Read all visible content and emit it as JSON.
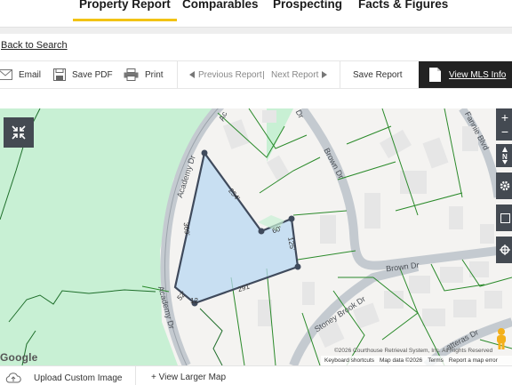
{
  "tabs": [
    {
      "label": "Property Report",
      "active": true
    },
    {
      "label": "Comparables",
      "active": false
    },
    {
      "label": "Prospecting",
      "active": false
    },
    {
      "label": "Facts & Figures",
      "active": false
    }
  ],
  "back_link": "Back to Search",
  "toolbar": {
    "email": "Email",
    "save_pdf": "Save PDF",
    "print": "Print",
    "previous_report": "Previous Report",
    "next_report": "Next Report",
    "save_report": "Save Report",
    "view_mls": "View MLS Info"
  },
  "map": {
    "roads": {
      "academy_dr_1": "Academy Dr",
      "academy_dr_2": "Academy Dr",
      "brown_dr_vertical": "Brown Dr",
      "brown_dr_horizontal": "Brown Dr",
      "stoney_brook_dr": "Stoney Brook Dr",
      "dr_top": "Dr",
      "fannie_blvd": "Fannie Blvd",
      "patteras": "atteras Dr"
    },
    "dimensions": [
      "254'",
      "369'",
      "60'",
      "125'",
      "291'",
      "52'"
    ],
    "address_number": "12",
    "google_logo": "Google",
    "attribution": {
      "copyright": "©2026 Courthouse Retrieval System, Inc. All Rights Reserved",
      "shortcuts": "Keyboard shortcuts",
      "map_data": "Map data ©2026",
      "terms": "Terms",
      "report": "Report a map error"
    },
    "colors": {
      "parcel_fill": "#b9d8f2",
      "parcel_stroke": "#3f4a5c",
      "park": "#c8f0d4",
      "lot_lines": "#2a8a2a"
    }
  },
  "footer": {
    "upload": "Upload Custom Image",
    "larger_map": "+ View Larger Map"
  }
}
